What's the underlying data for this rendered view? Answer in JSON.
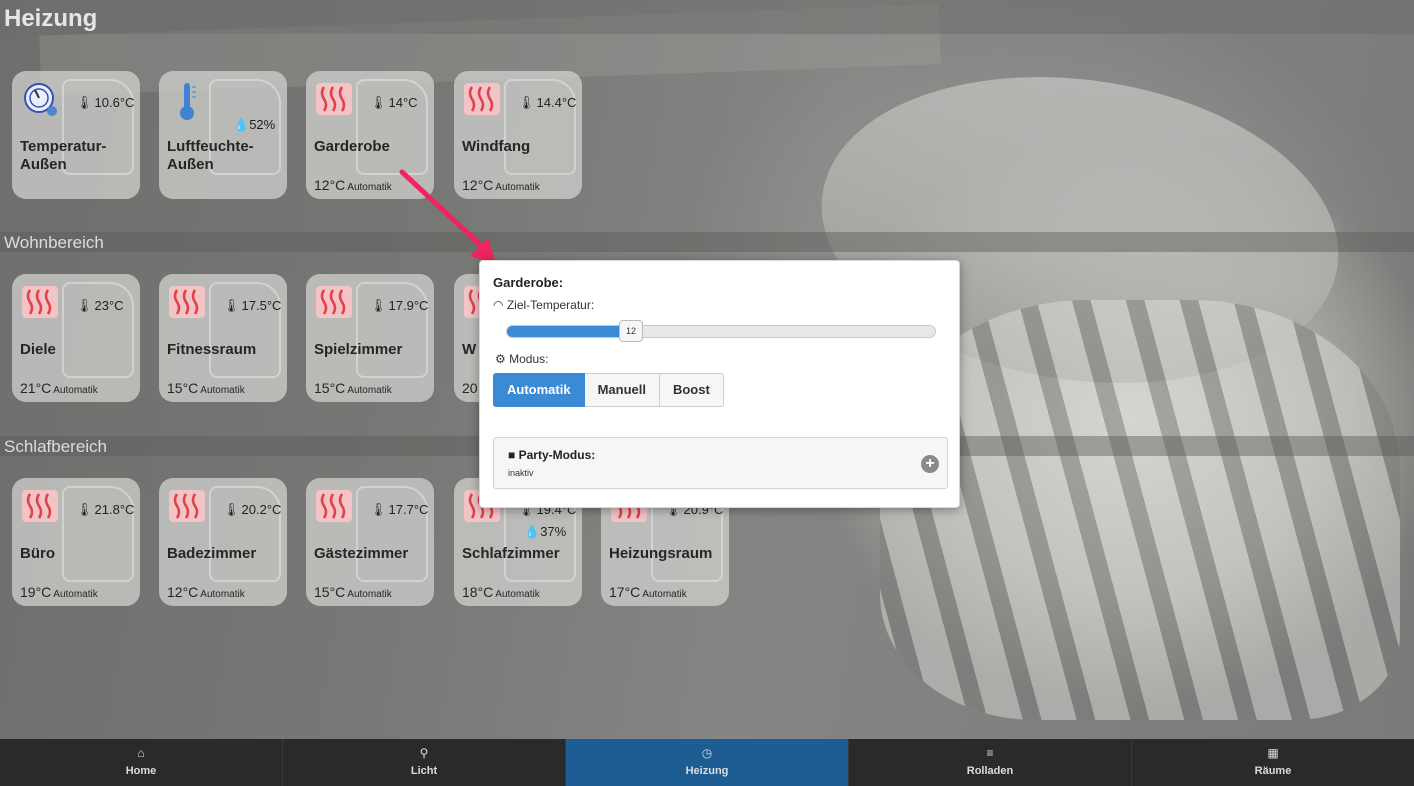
{
  "page": {
    "title": "Heizung"
  },
  "sections": {
    "wohnbereich": "Wohnbereich",
    "schlafbereich": "Schlafbereich"
  },
  "tiles": {
    "temp_aussen": {
      "name": "Temperatur-Außen",
      "temp": "10.6°C"
    },
    "luft_aussen": {
      "name": "Luftfeuchte-Außen",
      "humidity": "52%"
    },
    "garderobe": {
      "name": "Garderobe",
      "temp": "14°C",
      "target": "12°C",
      "mode": "Automatik"
    },
    "windfang": {
      "name": "Windfang",
      "temp": "14.4°C",
      "target": "12°C",
      "mode": "Automatik"
    },
    "diele": {
      "name": "Diele",
      "temp": "23°C",
      "target": "21°C",
      "mode": "Automatik"
    },
    "fitnessraum": {
      "name": "Fitnessraum",
      "temp": "17.5°C",
      "target": "15°C",
      "mode": "Automatik"
    },
    "spielzimmer": {
      "name": "Spielzimmer",
      "temp": "17.9°C",
      "target": "15°C",
      "mode": "Automatik"
    },
    "wohnen": {
      "name": "W",
      "target": "20"
    },
    "buero": {
      "name": "Büro",
      "temp": "21.8°C",
      "target": "19°C",
      "mode": "Automatik"
    },
    "badezimmer": {
      "name": "Badezimmer",
      "temp": "20.2°C",
      "target": "12°C",
      "mode": "Automatik"
    },
    "gaestezimmer": {
      "name": "Gästezimmer",
      "temp": "17.7°C",
      "target": "15°C",
      "mode": "Automatik"
    },
    "schlafzimmer": {
      "name": "Schlafzimmer",
      "temp": "19.4°C",
      "humidity": "37%",
      "target": "18°C",
      "mode": "Automatik"
    },
    "heizungsraum": {
      "name": "Heizungsraum",
      "temp": "20.9°C",
      "target": "17°C",
      "mode": "Automatik"
    }
  },
  "dialog": {
    "title": "Garderobe:",
    "target_label": "Ziel-Temperatur:",
    "slider_value": "12",
    "slider_fraction": 0.29,
    "mode_label": "Modus:",
    "modes": [
      "Automatik",
      "Manuell",
      "Boost"
    ],
    "active_mode": "Automatik",
    "party_label": "Party-Modus:",
    "party_state": "inaktiv"
  },
  "nav": [
    {
      "label": "Home",
      "icon": "home-icon"
    },
    {
      "label": "Licht",
      "icon": "map-pin-icon"
    },
    {
      "label": "Heizung",
      "icon": "clock-icon",
      "active": true
    },
    {
      "label": "Rolladen",
      "icon": "bars-icon"
    },
    {
      "label": "Räume",
      "icon": "grid-icon"
    }
  ],
  "colors": {
    "accent": "#3a8ad6",
    "nav_active": "#1d5d94",
    "navbar": "#2a2a2a",
    "pointer": "#f0245e"
  }
}
